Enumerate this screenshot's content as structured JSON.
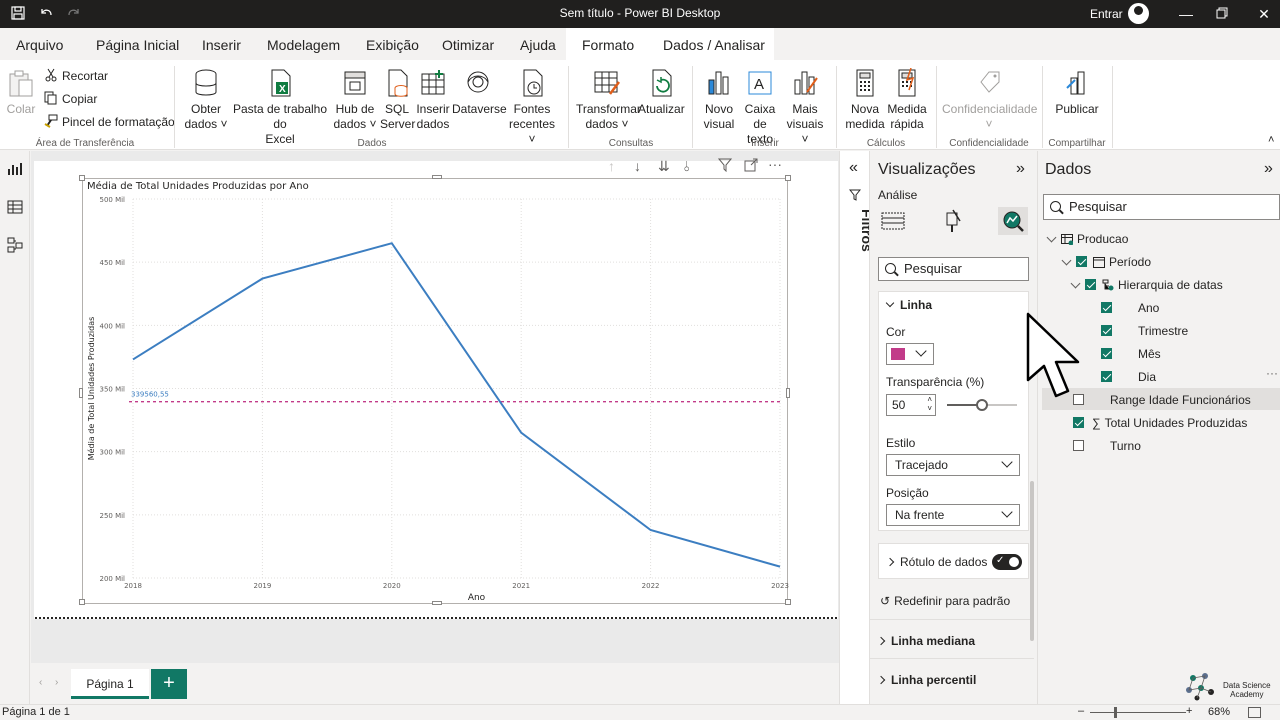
{
  "titlebar": {
    "title": "Sem título - Power BI Desktop",
    "signin": "Entrar"
  },
  "tabs": [
    {
      "label": "Arquivo"
    },
    {
      "label": "Página Inicial"
    },
    {
      "label": "Inserir"
    },
    {
      "label": "Modelagem"
    },
    {
      "label": "Exibição"
    },
    {
      "label": "Otimizar"
    },
    {
      "label": "Ajuda"
    },
    {
      "label": "Formato"
    },
    {
      "label": "Dados / Analisar"
    }
  ],
  "ribbon": {
    "clipboard": {
      "paste": "Colar",
      "cut": "Recortar",
      "copy": "Copiar",
      "format_painter": "Pincel de formatação",
      "group": "Área de Transferência"
    },
    "data": {
      "get_data_1": "Obter",
      "get_data_2": "dados",
      "excel_1": "Pasta de trabalho do",
      "excel_2": "Excel",
      "hub_1": "Hub de",
      "hub_2": "dados",
      "sql_1": "SQL",
      "sql_2": "Server",
      "enter_1": "Inserir",
      "enter_2": "dados",
      "dataverse": "Dataverse",
      "recent_1": "Fontes",
      "recent_2": "recentes",
      "group": "Dados"
    },
    "queries": {
      "transform_1": "Transformar",
      "transform_2": "dados",
      "refresh": "Atualizar",
      "group": "Consultas"
    },
    "insert": {
      "new_visual_1": "Novo",
      "new_visual_2": "visual",
      "textbox_1": "Caixa de",
      "textbox_2": "texto",
      "more_1": "Mais",
      "more_2": "visuais",
      "group": "Inserir"
    },
    "calc": {
      "new_measure_1": "Nova",
      "new_measure_2": "medida",
      "quick_1": "Medida",
      "quick_2": "rápida",
      "group": "Cálculos"
    },
    "sensitivity": {
      "label": "Confidencialidade",
      "group": "Confidencialidade"
    },
    "share": {
      "publish": "Publicar",
      "group": "Compartilhar"
    }
  },
  "chart_data": {
    "type": "line",
    "title": "Média de Total Unidades Produzidas por Ano",
    "xlabel": "Ano",
    "ylabel": "Média de Total Unidades Produzidas",
    "categories": [
      "2018",
      "2019",
      "2020",
      "2021",
      "2022",
      "2023"
    ],
    "series": [
      {
        "values": [
          373000,
          437000,
          465000,
          315000,
          238000,
          209000
        ],
        "color": "#3c7ec1"
      }
    ],
    "yticks": [
      "200 Mil",
      "250 Mil",
      "300 Mil",
      "350 Mil",
      "400 Mil",
      "450 Mil",
      "500 Mil"
    ],
    "ylim": [
      200000,
      500000
    ],
    "reference_line": {
      "value": 339560.55,
      "label": "339560,55",
      "color": "#c23b89",
      "style": "dashed"
    },
    "grid": true
  },
  "pages": {
    "tab_label": "Página 1",
    "add_label": "+"
  },
  "status": {
    "page_info": "Página 1 de 1",
    "zoom": "68%"
  },
  "filters": {
    "label": "Filtros"
  },
  "visualizations": {
    "title": "Visualizações",
    "subtitle": "Análise",
    "search_placeholder": "Pesquisar",
    "line_section": "Linha",
    "color_label": "Cor",
    "color_value": "#c23b89",
    "transparency_label": "Transparência (%)",
    "transparency_value": "50",
    "style_label": "Estilo",
    "style_value": "Tracejado",
    "position_label": "Posição",
    "position_value": "Na frente",
    "data_labels": "Rótulo de dados",
    "reset": "Redefinir para padrão",
    "median_line": "Linha mediana",
    "percentile_line": "Linha percentil"
  },
  "data_pane": {
    "title": "Dados",
    "search_placeholder": "Pesquisar",
    "table": "Producao",
    "period": "Período",
    "hierarchy": "Hierarquia de datas",
    "year": "Ano",
    "quarter": "Trimestre",
    "month": "Mês",
    "day": "Dia",
    "age_range": "Range Idade Funcionários",
    "total_units": "Total Unidades Produzidas",
    "shift": "Turno"
  },
  "logo": {
    "line1": "Data Science",
    "line2": "Academy"
  },
  "colors": {
    "accent": "#117865",
    "line": "#3c7ec1",
    "ref_line": "#c23b89"
  }
}
